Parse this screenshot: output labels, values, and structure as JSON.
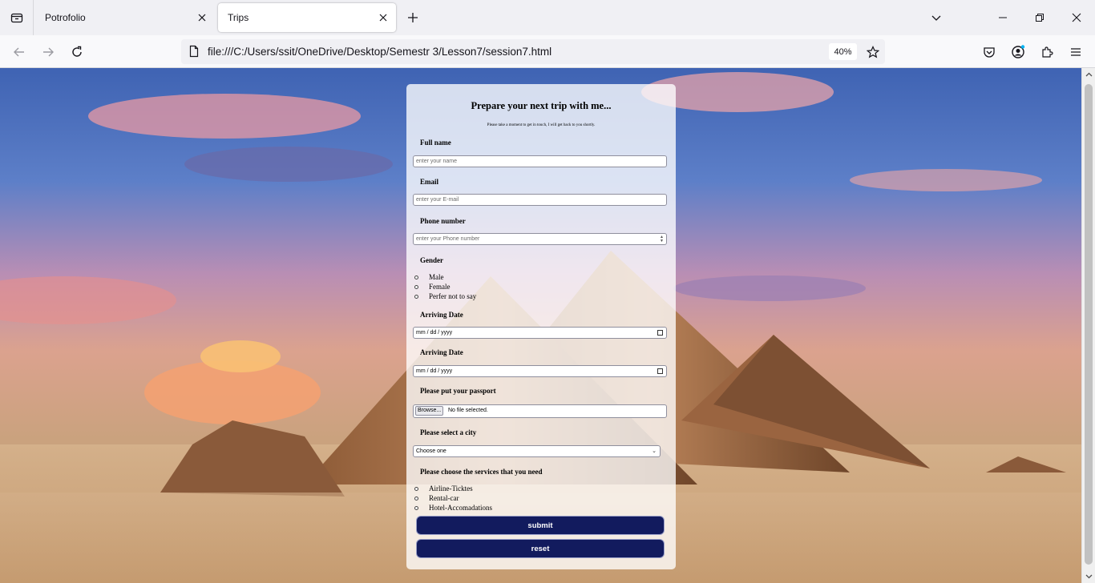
{
  "browser": {
    "tabs": [
      {
        "title": "Potrofolio",
        "active": false
      },
      {
        "title": "Trips",
        "active": true
      }
    ],
    "url": "file:///C:/Users/ssit/OneDrive/Desktop/Semestr 3/Lesson7/session7.html",
    "zoom": "40%"
  },
  "form": {
    "title": "Prepare your next trip with me...",
    "subtitle": "Please take a moment to get in touch, I will get back to you shortly.",
    "full_name": {
      "label": "Full name",
      "placeholder": "enter your name"
    },
    "email": {
      "label": "Email",
      "placeholder": "enter your E-mail"
    },
    "phone": {
      "label": "Phone number",
      "placeholder": "enter your Phone number"
    },
    "gender": {
      "label": "Gender",
      "options": [
        "Male",
        "Female",
        "Perfer not to say"
      ]
    },
    "arriving_date_1": {
      "label": "Arriving Date",
      "value": "mm / dd / yyyy"
    },
    "arriving_date_2": {
      "label": "Arriving Date",
      "value": "mm / dd / yyyy"
    },
    "passport": {
      "label": "Please put your passport",
      "browse_label": "Browse...",
      "status": "No file selected."
    },
    "city": {
      "label": "Please select a city",
      "selected": "Choose one"
    },
    "services": {
      "label": "Please choose the services that you need",
      "options": [
        "Airline-Ticktes",
        "Rental-car",
        "Hotel-Accomadations"
      ]
    },
    "submit_label": "submit",
    "reset_label": "reset"
  },
  "colors": {
    "button_bg": "#121b5e",
    "button_text": "#ffffff",
    "card_bg": "rgba(255,255,255,0.78)"
  }
}
